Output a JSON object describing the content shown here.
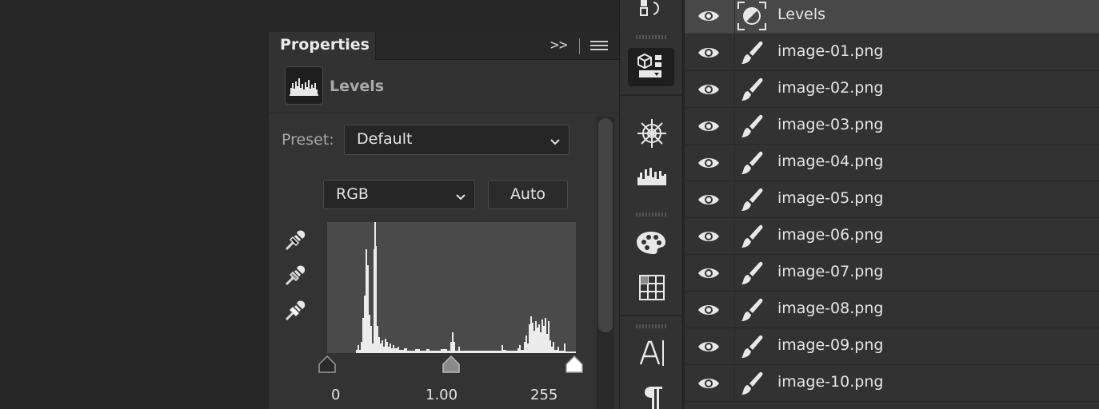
{
  "properties_panel": {
    "tab_label": "Properties",
    "menu_expand_glyph": ">>",
    "adjustment_title": "Levels",
    "preset_label": "Preset:",
    "preset_value": "Default",
    "channel_value": "RGB",
    "auto_label": "Auto",
    "input_black": "0",
    "input_gamma": "1.00",
    "input_white": "255"
  },
  "tools": [
    "adjustments-icon",
    "libraries-icon",
    "navigator-wheel-icon",
    "histogram-icon",
    "swatches-palette-icon",
    "grid-icon",
    "character-icon",
    "paragraph-icon"
  ],
  "layers": [
    {
      "name": "Levels",
      "type": "adjustment",
      "visible": true,
      "selected": true
    },
    {
      "name": "image-01.png",
      "type": "pixel",
      "visible": true
    },
    {
      "name": "image-02.png",
      "type": "pixel",
      "visible": true
    },
    {
      "name": "image-03.png",
      "type": "pixel",
      "visible": true
    },
    {
      "name": "image-04.png",
      "type": "pixel",
      "visible": true
    },
    {
      "name": "image-05.png",
      "type": "pixel",
      "visible": true
    },
    {
      "name": "image-06.png",
      "type": "pixel",
      "visible": true
    },
    {
      "name": "image-07.png",
      "type": "pixel",
      "visible": true
    },
    {
      "name": "image-08.png",
      "type": "pixel",
      "visible": true
    },
    {
      "name": "image-09.png",
      "type": "pixel",
      "visible": true
    },
    {
      "name": "image-10.png",
      "type": "pixel",
      "visible": true
    }
  ],
  "colors": {
    "panel_bg": "#323232",
    "workspace_bg": "#262626",
    "selected_row": "#484848",
    "text": "#e6e6e6",
    "muted_text": "#a9a9a9"
  }
}
